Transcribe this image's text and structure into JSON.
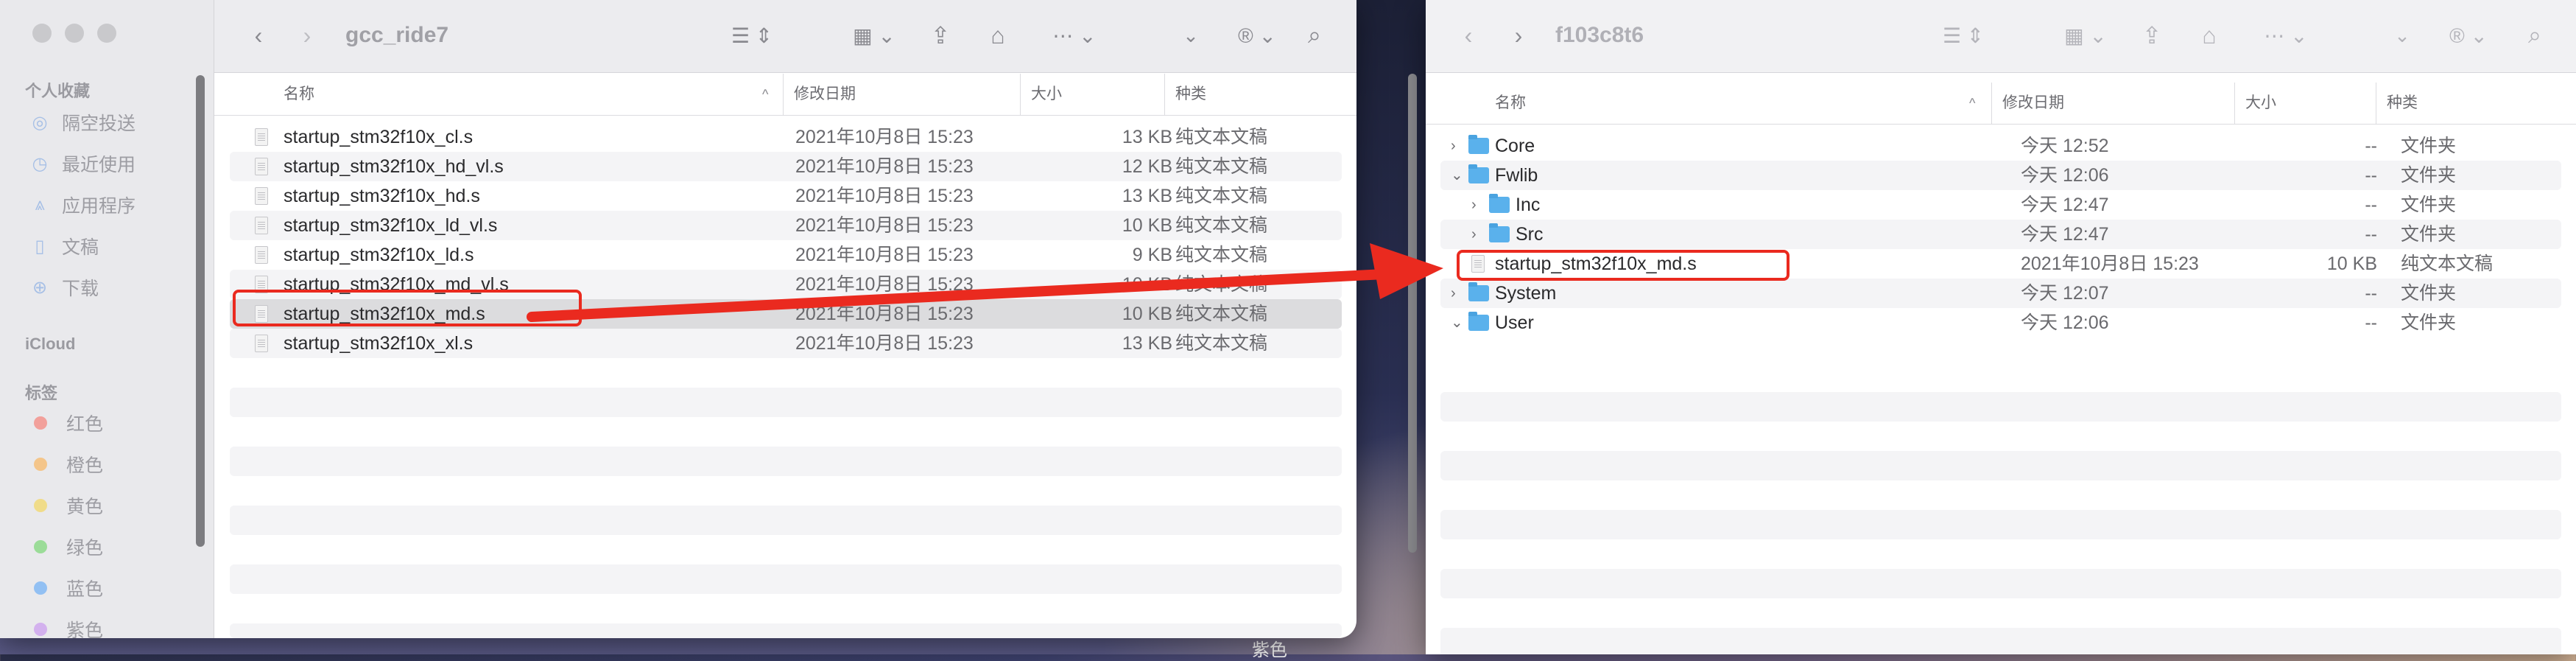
{
  "left_window": {
    "title": "gcc_ride7",
    "sidebar": {
      "favorites_header": "个人收藏",
      "favorites": [
        {
          "label": "隔空投送",
          "icon": "airdrop-icon"
        },
        {
          "label": "最近使用",
          "icon": "clock-icon"
        },
        {
          "label": "应用程序",
          "icon": "applications-icon"
        },
        {
          "label": "文稿",
          "icon": "document-icon"
        },
        {
          "label": "下载",
          "icon": "download-icon"
        }
      ],
      "icloud_header": "iCloud",
      "tags_header": "标签",
      "tags": [
        {
          "label": "红色",
          "color": "#f2645c"
        },
        {
          "label": "橙色",
          "color": "#f5a33a"
        },
        {
          "label": "黄色",
          "color": "#f2cf3d"
        },
        {
          "label": "绿色",
          "color": "#5bc85a"
        },
        {
          "label": "蓝色",
          "color": "#4a9cf2"
        },
        {
          "label": "紫色",
          "color": "#b57be0"
        }
      ]
    },
    "columns": {
      "name": "名称",
      "date": "修改日期",
      "size": "大小",
      "kind": "种类"
    },
    "files": [
      {
        "name": "startup_stm32f10x_cl.s",
        "date": "2021年10月8日 15:23",
        "size": "13 KB",
        "kind": "纯文本文稿"
      },
      {
        "name": "startup_stm32f10x_hd_vl.s",
        "date": "2021年10月8日 15:23",
        "size": "12 KB",
        "kind": "纯文本文稿"
      },
      {
        "name": "startup_stm32f10x_hd.s",
        "date": "2021年10月8日 15:23",
        "size": "13 KB",
        "kind": "纯文本文稿"
      },
      {
        "name": "startup_stm32f10x_ld_vl.s",
        "date": "2021年10月8日 15:23",
        "size": "10 KB",
        "kind": "纯文本文稿"
      },
      {
        "name": "startup_stm32f10x_ld.s",
        "date": "2021年10月8日 15:23",
        "size": "9 KB",
        "kind": "纯文本文稿"
      },
      {
        "name": "startup_stm32f10x_md_vl.s",
        "date": "2021年10月8日 15:23",
        "size": "10 KB",
        "kind": "纯文本文稿"
      },
      {
        "name": "startup_stm32f10x_md.s",
        "date": "2021年10月8日 15:23",
        "size": "10 KB",
        "kind": "纯文本文稿"
      },
      {
        "name": "startup_stm32f10x_xl.s",
        "date": "2021年10月8日 15:23",
        "size": "13 KB",
        "kind": "纯文本文稿"
      }
    ]
  },
  "right_window": {
    "title": "f103c8t6",
    "columns": {
      "name": "名称",
      "date": "修改日期",
      "size": "大小",
      "kind": "种类"
    },
    "items": [
      {
        "name": "Core",
        "date": "今天 12:52",
        "size": "--",
        "kind": "文件夹",
        "type": "folder",
        "chevron": "›"
      },
      {
        "name": "Fwlib",
        "date": "今天 12:06",
        "size": "--",
        "kind": "文件夹",
        "type": "folder",
        "chevron": "⌄"
      },
      {
        "name": "Inc",
        "date": "今天 12:47",
        "size": "--",
        "kind": "文件夹",
        "type": "folder",
        "chevron": "›"
      },
      {
        "name": "Src",
        "date": "今天 12:47",
        "size": "--",
        "kind": "文件夹",
        "type": "folder",
        "chevron": "›"
      },
      {
        "name": "startup_stm32f10x_md.s",
        "date": "2021年10月8日 15:23",
        "size": "10 KB",
        "kind": "纯文本文稿",
        "type": "file",
        "chevron": ""
      },
      {
        "name": "System",
        "date": "今天 12:07",
        "size": "--",
        "kind": "文件夹",
        "type": "folder",
        "chevron": "›"
      },
      {
        "name": "User",
        "date": "今天 12:06",
        "size": "--",
        "kind": "文件夹",
        "type": "folder",
        "chevron": "⌄"
      }
    ]
  },
  "background_partial_label": "紫色",
  "annotation_color": "#ea2a1f"
}
